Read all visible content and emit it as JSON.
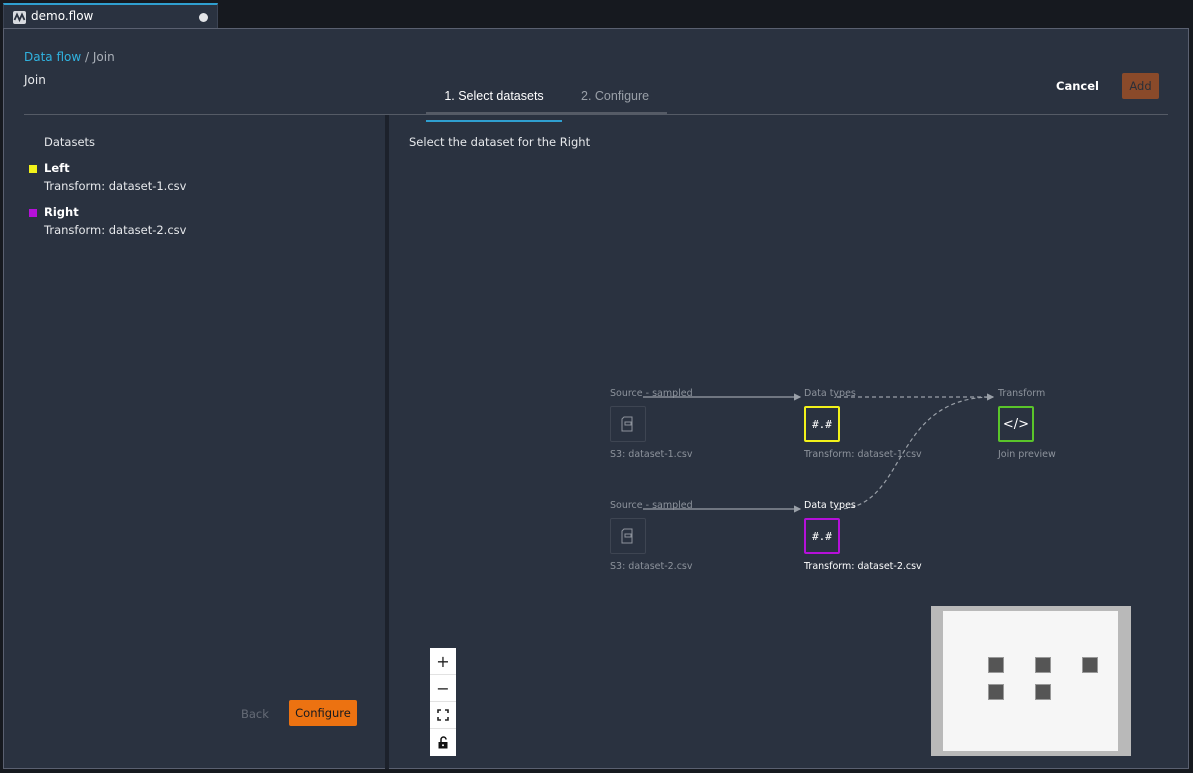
{
  "tab": {
    "title": "demo.flow",
    "icon": "wave-logo-icon",
    "unsaved": true
  },
  "breadcrumb": {
    "link": "Data flow",
    "separator": " / ",
    "current": "Join"
  },
  "page_title": "Join",
  "steps": [
    {
      "label": "1. Select datasets",
      "active": true
    },
    {
      "label": "2. Configure",
      "active": false
    }
  ],
  "header_actions": {
    "cancel": "Cancel",
    "add": "Add"
  },
  "left_panel": {
    "heading": "Datasets",
    "datasets": [
      {
        "label": "Left",
        "value": "Transform: dataset-1.csv",
        "color": "#f2f21a"
      },
      {
        "label": "Right",
        "value": "Transform: dataset-2.csv",
        "color": "#b510d9"
      }
    ],
    "back": "Back",
    "configure": "Configure"
  },
  "right_panel": {
    "prompt": "Select the dataset for the Right",
    "graph": {
      "nodes": [
        {
          "id": "src1",
          "title": "Source - sampled",
          "caption": "S3: dataset-1.csv",
          "icon": "file-icon"
        },
        {
          "id": "dt1",
          "title": "Data types",
          "caption": "Transform: dataset-1.csv",
          "glyph": "#.#",
          "color": "#f2f21a"
        },
        {
          "id": "tf",
          "title": "Transform",
          "caption": "Join preview",
          "glyph": "</>",
          "color": "#5ac52a"
        },
        {
          "id": "src2",
          "title": "Source - sampled",
          "caption": "S3: dataset-2.csv",
          "icon": "file-icon"
        },
        {
          "id": "dt2",
          "title": "Data types",
          "caption": "Transform: dataset-2.csv",
          "glyph": "#.#",
          "color": "#b510d9"
        }
      ]
    },
    "zoom_controls": {
      "zoom_in": "+",
      "zoom_out": "−",
      "fit": "⛶",
      "lock": "lock-open"
    }
  }
}
